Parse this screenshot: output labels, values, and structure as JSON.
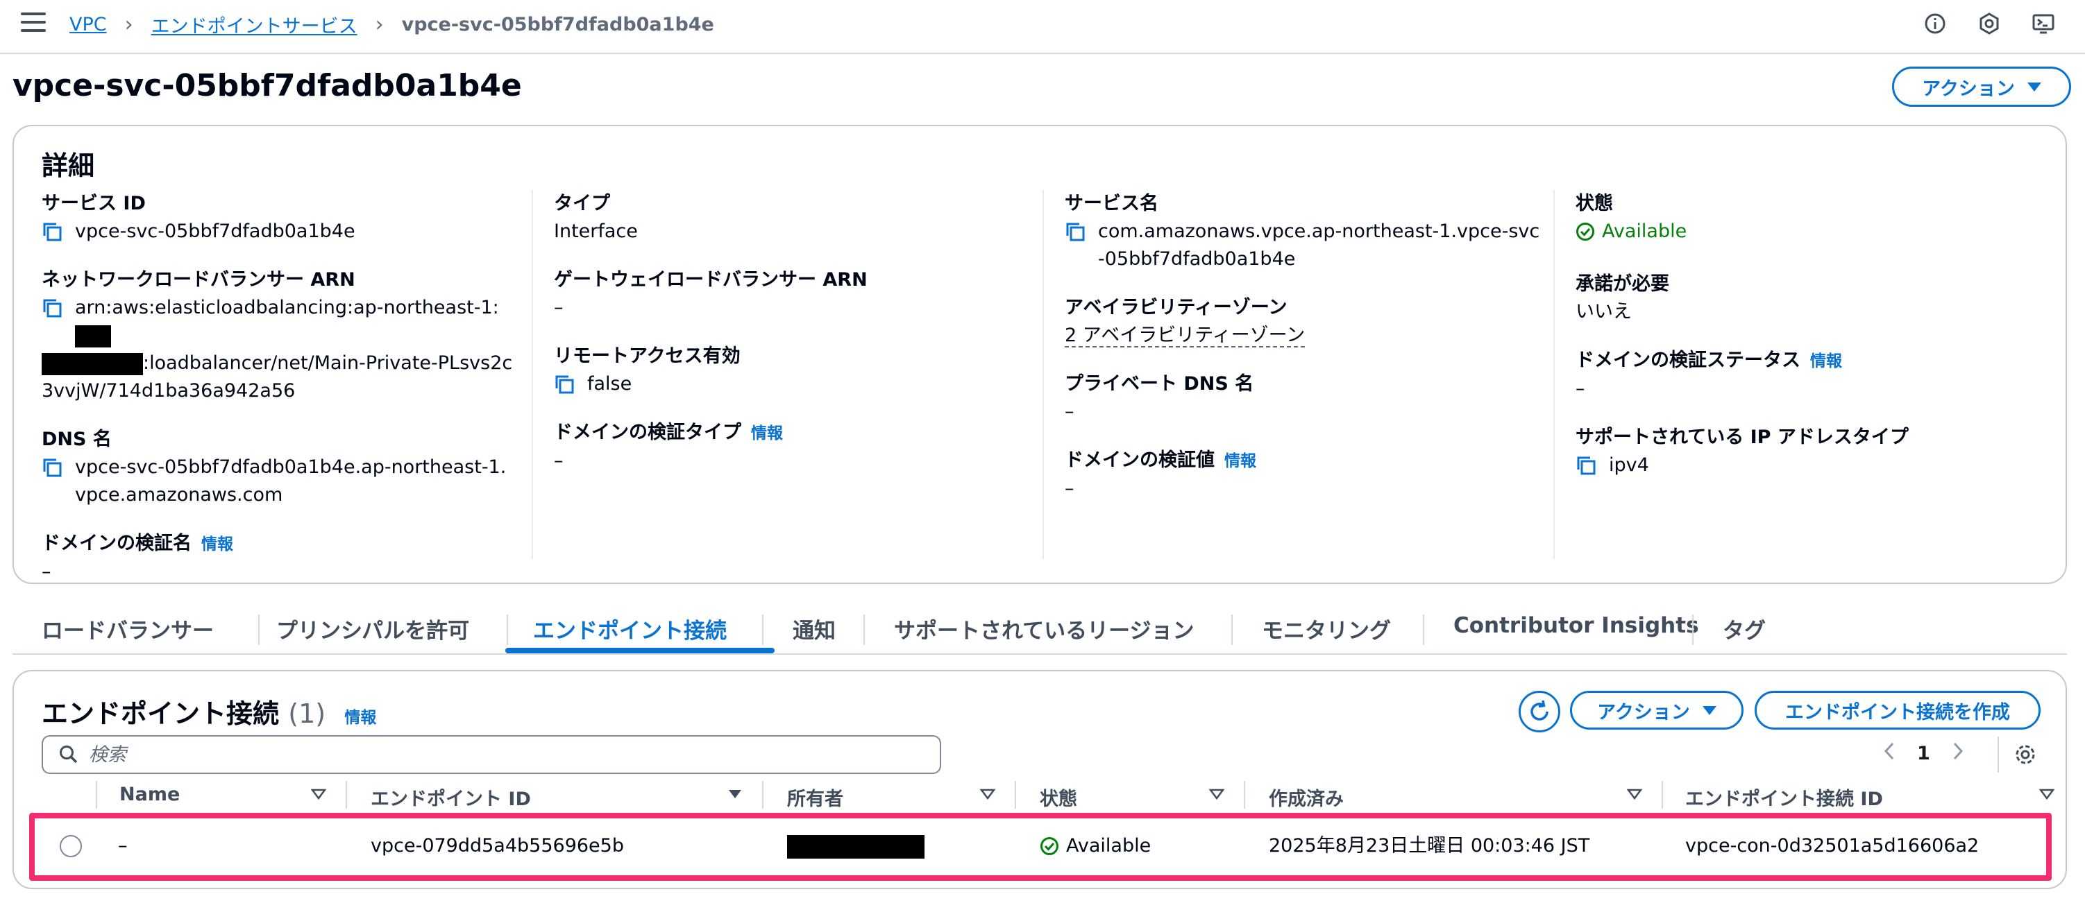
{
  "breadcrumb": {
    "root": "VPC",
    "parent": "エンドポイントサービス",
    "current": "vpce-svc-05bbf7dfadb0a1b4e"
  },
  "top_icons": [
    "info-icon",
    "feedback-icon",
    "cloudshell-icon"
  ],
  "page": {
    "title": "vpce-svc-05bbf7dfadb0a1b4e",
    "actions_label": "アクション"
  },
  "details": {
    "heading": "詳細",
    "info_label": "情報",
    "service_id_label": "サービス ID",
    "service_id": "vpce-svc-05bbf7dfadb0a1b4e",
    "nlb_arn_label": "ネットワークロードバランサー ARN",
    "nlb_arn_prefix": "arn:aws:elasticloadbalancing:ap-northeast-1:",
    "nlb_arn_suffix": ":loadbalancer/net/Main-Private-PLsvs2c3vvjW/714d1ba36a942a56",
    "dns_label": "DNS 名",
    "dns_value": "vpce-svc-05bbf7dfadb0a1b4e.ap-northeast-1.vpce.amazonaws.com",
    "domain_verify_name_label": "ドメインの検証名",
    "domain_verify_name": "–",
    "type_label": "タイプ",
    "type_value": "Interface",
    "glb_arn_label": "ゲートウェイロードバランサー ARN",
    "glb_arn": "–",
    "remote_access_label": "リモートアクセス有効",
    "remote_access": "false",
    "domain_verify_type_label": "ドメインの検証タイプ",
    "domain_verify_type": "–",
    "service_name_label": "サービス名",
    "service_name": "com.amazonaws.vpce.ap-northeast-1.vpce-svc-05bbf7dfadb0a1b4e",
    "az_label": "アベイラビリティーゾーン",
    "az_value": "2 アベイラビリティーゾーン",
    "private_dns_label": "プライベート DNS 名",
    "private_dns": "–",
    "domain_verify_value_label": "ドメインの検証値",
    "domain_verify_value": "–",
    "state_label": "状態",
    "state_value": "Available",
    "acceptance_label": "承諾が必要",
    "acceptance_value": "いいえ",
    "domain_verify_status_label": "ドメインの検証ステータス",
    "domain_verify_status": "–",
    "ip_type_label": "サポートされている IP アドレスタイプ",
    "ip_type": "ipv4"
  },
  "tabs": [
    {
      "label": "ロードバランサー"
    },
    {
      "label": "プリンシパルを許可"
    },
    {
      "label": "エンドポイント接続"
    },
    {
      "label": "通知"
    },
    {
      "label": "サポートされているリージョン"
    },
    {
      "label": "モニタリング"
    },
    {
      "label": "Contributor Insights"
    },
    {
      "label": "タグ"
    }
  ],
  "active_tab_index": 2,
  "connections": {
    "title": "エンドポイント接続",
    "count": "(1)",
    "info_label": "情報",
    "actions_label": "アクション",
    "create_label": "エンドポイント接続を作成",
    "search_placeholder": "検索",
    "page_number": "1",
    "columns": [
      "Name",
      "エンドポイント ID",
      "所有者",
      "状態",
      "作成済み",
      "エンドポイント接続 ID"
    ],
    "rows": [
      {
        "name": "–",
        "endpoint_id": "vpce-079dd5a4b55696e5b",
        "state": "Available",
        "created": "2025年8月23日土曜日 00:03:46 JST",
        "connection_id": "vpce-con-0d32501a5d16606a2"
      }
    ]
  },
  "colors": {
    "accent": "#0972d3",
    "success": "#037f0c",
    "highlight": "#f42b6e"
  }
}
